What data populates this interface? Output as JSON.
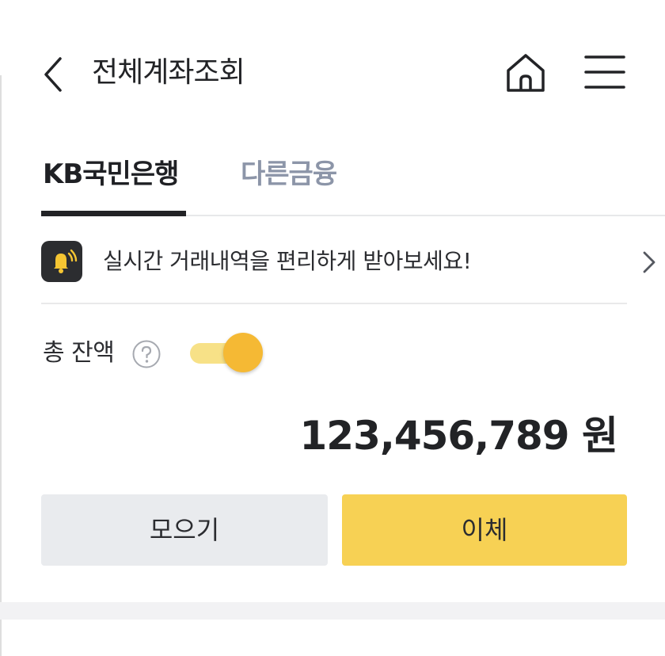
{
  "header": {
    "title": "전체계좌조회",
    "back_icon": "chevron-left-icon",
    "home_icon": "home-icon",
    "menu_icon": "hamburger-menu-icon"
  },
  "tabs": [
    {
      "label": "KB국민은행",
      "active": true
    },
    {
      "label": "다른금융",
      "active": false
    }
  ],
  "notice": {
    "icon": "bell-icon",
    "text": "실시간 거래내역을 편리하게 받아보세요!",
    "arrow_icon": "chevron-right-icon"
  },
  "balance": {
    "label": "총 잔액",
    "help_icon": "question-circle-icon",
    "toggle_on": true,
    "amount": "123,456,789 원"
  },
  "actions": {
    "collect_label": "모으기",
    "transfer_label": "이체"
  },
  "colors": {
    "accent": "#f7d154",
    "toggle_knob": "#f5b934",
    "toggle_track": "#f7e187",
    "inactive_tab": "#8c95a8",
    "secondary_button": "#e9ebee"
  }
}
